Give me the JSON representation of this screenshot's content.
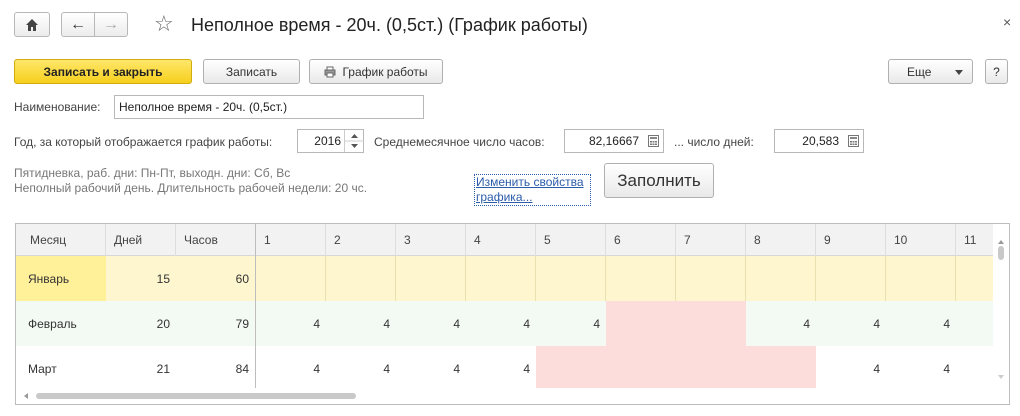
{
  "window": {
    "title": "Неполное время - 20ч. (0,5ст.) (График работы)",
    "close_glyph": "×"
  },
  "nav": {
    "home_glyph": "⌂",
    "back_glyph": "←",
    "forward_glyph": "→",
    "star_glyph": "☆"
  },
  "toolbar": {
    "save_close_label": "Записать и закрыть",
    "save_label": "Записать",
    "schedule_label": "График работы",
    "more_label": "Еще",
    "help_label": "?"
  },
  "form": {
    "name_label": "Наименование:",
    "name_value": "Неполное время - 20ч. (0,5ст.)",
    "year_label": "Год, за который отображается график работы:",
    "year_value": "2016",
    "avg_hours_label": "Среднемесячное число часов:",
    "avg_hours_value": "82,16667",
    "days_label": "... число дней:",
    "days_value": "20,583",
    "info_line1": "Пятидневка, раб. дни: Пн-Пт, выходн. дни: Сб, Вс",
    "info_line2": "Неполный рабочий день. Длительность рабочей недели: 20 чс.",
    "change_link_line1": "Изменить свойства",
    "change_link_line2": "графика...",
    "fill_label": "Заполнить"
  },
  "colors": {
    "selected_month": "#fff19a",
    "selected_row": "#fdf6cf",
    "weekend": "#fddcdc",
    "alt_row": "#f3f9f3"
  },
  "grid": {
    "columns": [
      "Месяц",
      "Дней",
      "Часов",
      "1",
      "2",
      "3",
      "4",
      "5",
      "6",
      "7",
      "8",
      "9",
      "10",
      "11"
    ],
    "rows": [
      {
        "month": "Январь",
        "days": "15",
        "hours": "60",
        "cells": [
          "",
          "",
          "",
          "",
          "",
          "",
          "",
          "",
          "",
          "",
          ""
        ]
      },
      {
        "month": "Февраль",
        "days": "20",
        "hours": "79",
        "cells": [
          "4",
          "4",
          "4",
          "4",
          "4",
          "",
          "",
          "4",
          "4",
          "4",
          ""
        ]
      },
      {
        "month": "Март",
        "days": "21",
        "hours": "84",
        "cells": [
          "4",
          "4",
          "4",
          "4",
          "",
          "",
          "",
          "",
          "4",
          "4",
          ""
        ]
      }
    ]
  }
}
